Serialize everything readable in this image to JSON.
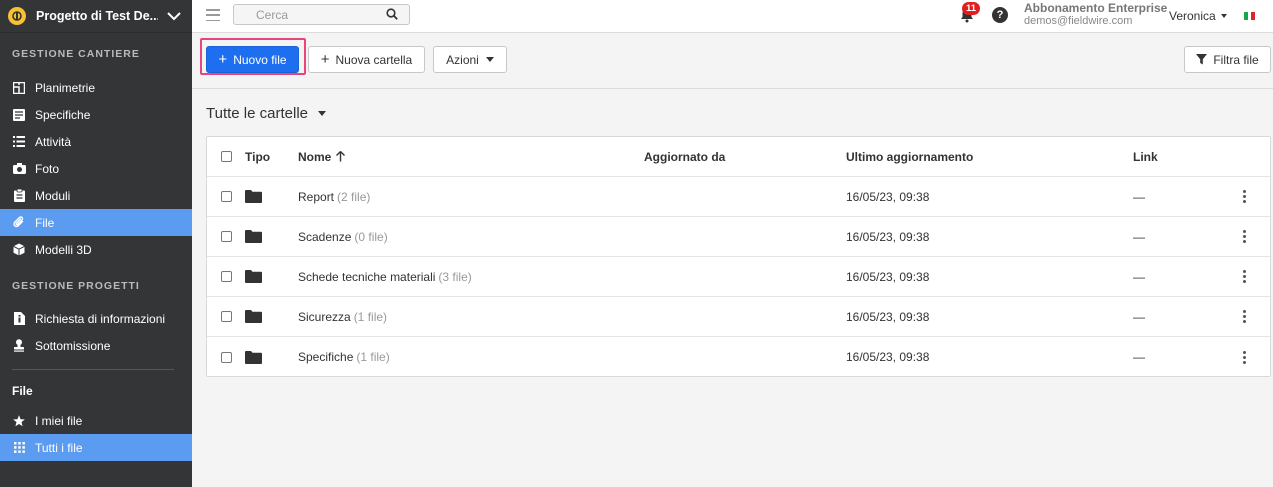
{
  "project": {
    "name": "Progetto di Test De..."
  },
  "sidebar": {
    "section1_title": "GESTIONE CANTIERE",
    "section1_items": [
      {
        "label": "Planimetrie",
        "icon": "floorplan-icon"
      },
      {
        "label": "Specifiche",
        "icon": "specs-icon"
      },
      {
        "label": "Attività",
        "icon": "list-icon"
      },
      {
        "label": "Foto",
        "icon": "camera-icon"
      },
      {
        "label": "Moduli",
        "icon": "clipboard-icon"
      },
      {
        "label": "File",
        "icon": "paperclip-icon",
        "active": true
      },
      {
        "label": "Modelli 3D",
        "icon": "cube-icon"
      }
    ],
    "section2_title": "GESTIONE PROGETTI",
    "section2_items": [
      {
        "label": "Richiesta di informazioni",
        "icon": "info-doc-icon"
      },
      {
        "label": "Sottomissione",
        "icon": "stamp-icon"
      }
    ],
    "file_section_title": "File",
    "file_items": [
      {
        "label": "I miei file",
        "icon": "star-icon"
      },
      {
        "label": "Tutti i file",
        "icon": "grid-icon",
        "active": true
      }
    ]
  },
  "topbar": {
    "search_placeholder": "Cerca",
    "notifications_count": "11",
    "help_label": "?",
    "subscription_title": "Abbonamento Enterprise",
    "subscription_email": "demos@fieldwire.com",
    "user_name": "Veronica"
  },
  "toolbar": {
    "new_file_label": "Nuovo file",
    "new_folder_label": "Nuova cartella",
    "actions_label": "Azioni",
    "filter_label": "Filtra file"
  },
  "folders_heading": "Tutte le cartelle",
  "table": {
    "headers": {
      "type": "Tipo",
      "name": "Nome",
      "updated_by": "Aggiornato da",
      "last_update": "Ultimo aggiornamento",
      "link": "Link"
    },
    "rows": [
      {
        "name": "Report",
        "count": "(2 file)",
        "updated_by": "",
        "last_update": "16/05/23, 09:38",
        "link": "—"
      },
      {
        "name": "Scadenze",
        "count": "(0 file)",
        "updated_by": "",
        "last_update": "16/05/23, 09:38",
        "link": "—"
      },
      {
        "name": "Schede tecniche materiali",
        "count": "(3 file)",
        "updated_by": "",
        "last_update": "16/05/23, 09:38",
        "link": "—"
      },
      {
        "name": "Sicurezza",
        "count": "(1 file)",
        "updated_by": "",
        "last_update": "16/05/23, 09:38",
        "link": "—"
      },
      {
        "name": "Specifiche",
        "count": "(1 file)",
        "updated_by": "",
        "last_update": "16/05/23, 09:38",
        "link": "—"
      }
    ]
  },
  "colors": {
    "sidebar_bg": "#333537",
    "sidebar_active": "#5b9bf0",
    "primary_button": "#1e6ff0",
    "highlight_border": "#e8457e",
    "badge": "#e02020"
  }
}
